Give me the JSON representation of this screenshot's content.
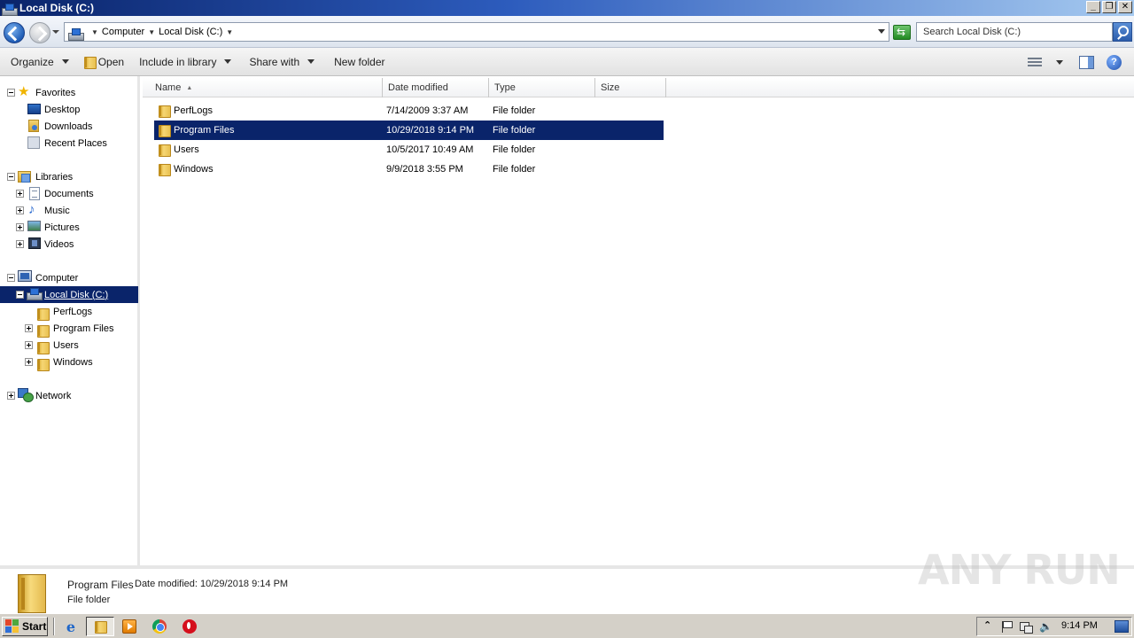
{
  "window": {
    "title": "Local Disk (C:)",
    "buttons": {
      "minimize": "_",
      "restore": "❐",
      "close": "✕"
    }
  },
  "address": {
    "segments": [
      "Computer",
      "Local Disk (C:)"
    ],
    "search_placeholder": "Search Local Disk (C:)"
  },
  "toolbar": {
    "organize": "Organize",
    "open": "Open",
    "include_in_library": "Include in library",
    "share_with": "Share with",
    "new_folder": "New folder",
    "help": "?"
  },
  "nav": {
    "favorites": "Favorites",
    "desktop": "Desktop",
    "downloads": "Downloads",
    "recent_places": "Recent Places",
    "libraries": "Libraries",
    "documents": "Documents",
    "music": "Music",
    "pictures": "Pictures",
    "videos": "Videos",
    "computer": "Computer",
    "local_disk": "Local Disk (C:)",
    "perflogs": "PerfLogs",
    "program_files": "Program Files",
    "users": "Users",
    "windows": "Windows",
    "network": "Network"
  },
  "columns": {
    "name": "Name",
    "date_modified": "Date modified",
    "type": "Type",
    "size": "Size"
  },
  "files": [
    {
      "name": "PerfLogs",
      "date": "7/14/2009 3:37 AM",
      "type": "File folder",
      "size": ""
    },
    {
      "name": "Program Files",
      "date": "10/29/2018 9:14 PM",
      "type": "File folder",
      "size": ""
    },
    {
      "name": "Users",
      "date": "10/5/2017 10:49 AM",
      "type": "File folder",
      "size": ""
    },
    {
      "name": "Windows",
      "date": "9/9/2018 3:55 PM",
      "type": "File folder",
      "size": ""
    }
  ],
  "selected_file_index": 1,
  "details": {
    "name": "Program Files",
    "date_label": "Date modified:",
    "date_value": "10/29/2018 9:14 PM",
    "type": "File folder"
  },
  "watermark": "ANY RUN",
  "taskbar": {
    "start": "Start",
    "tray_arrow": "⌃",
    "clock": "9:14 PM",
    "quick_launch_icons": [
      "internet-explorer-icon",
      "windows-explorer-icon",
      "media-player-icon",
      "chrome-icon",
      "opera-icon"
    ]
  },
  "colors": {
    "selection": "#0a246a",
    "title_bar_start": "#0a246a",
    "title_bar_end": "#a6caf0",
    "taskbar": "#d4d0c8"
  }
}
